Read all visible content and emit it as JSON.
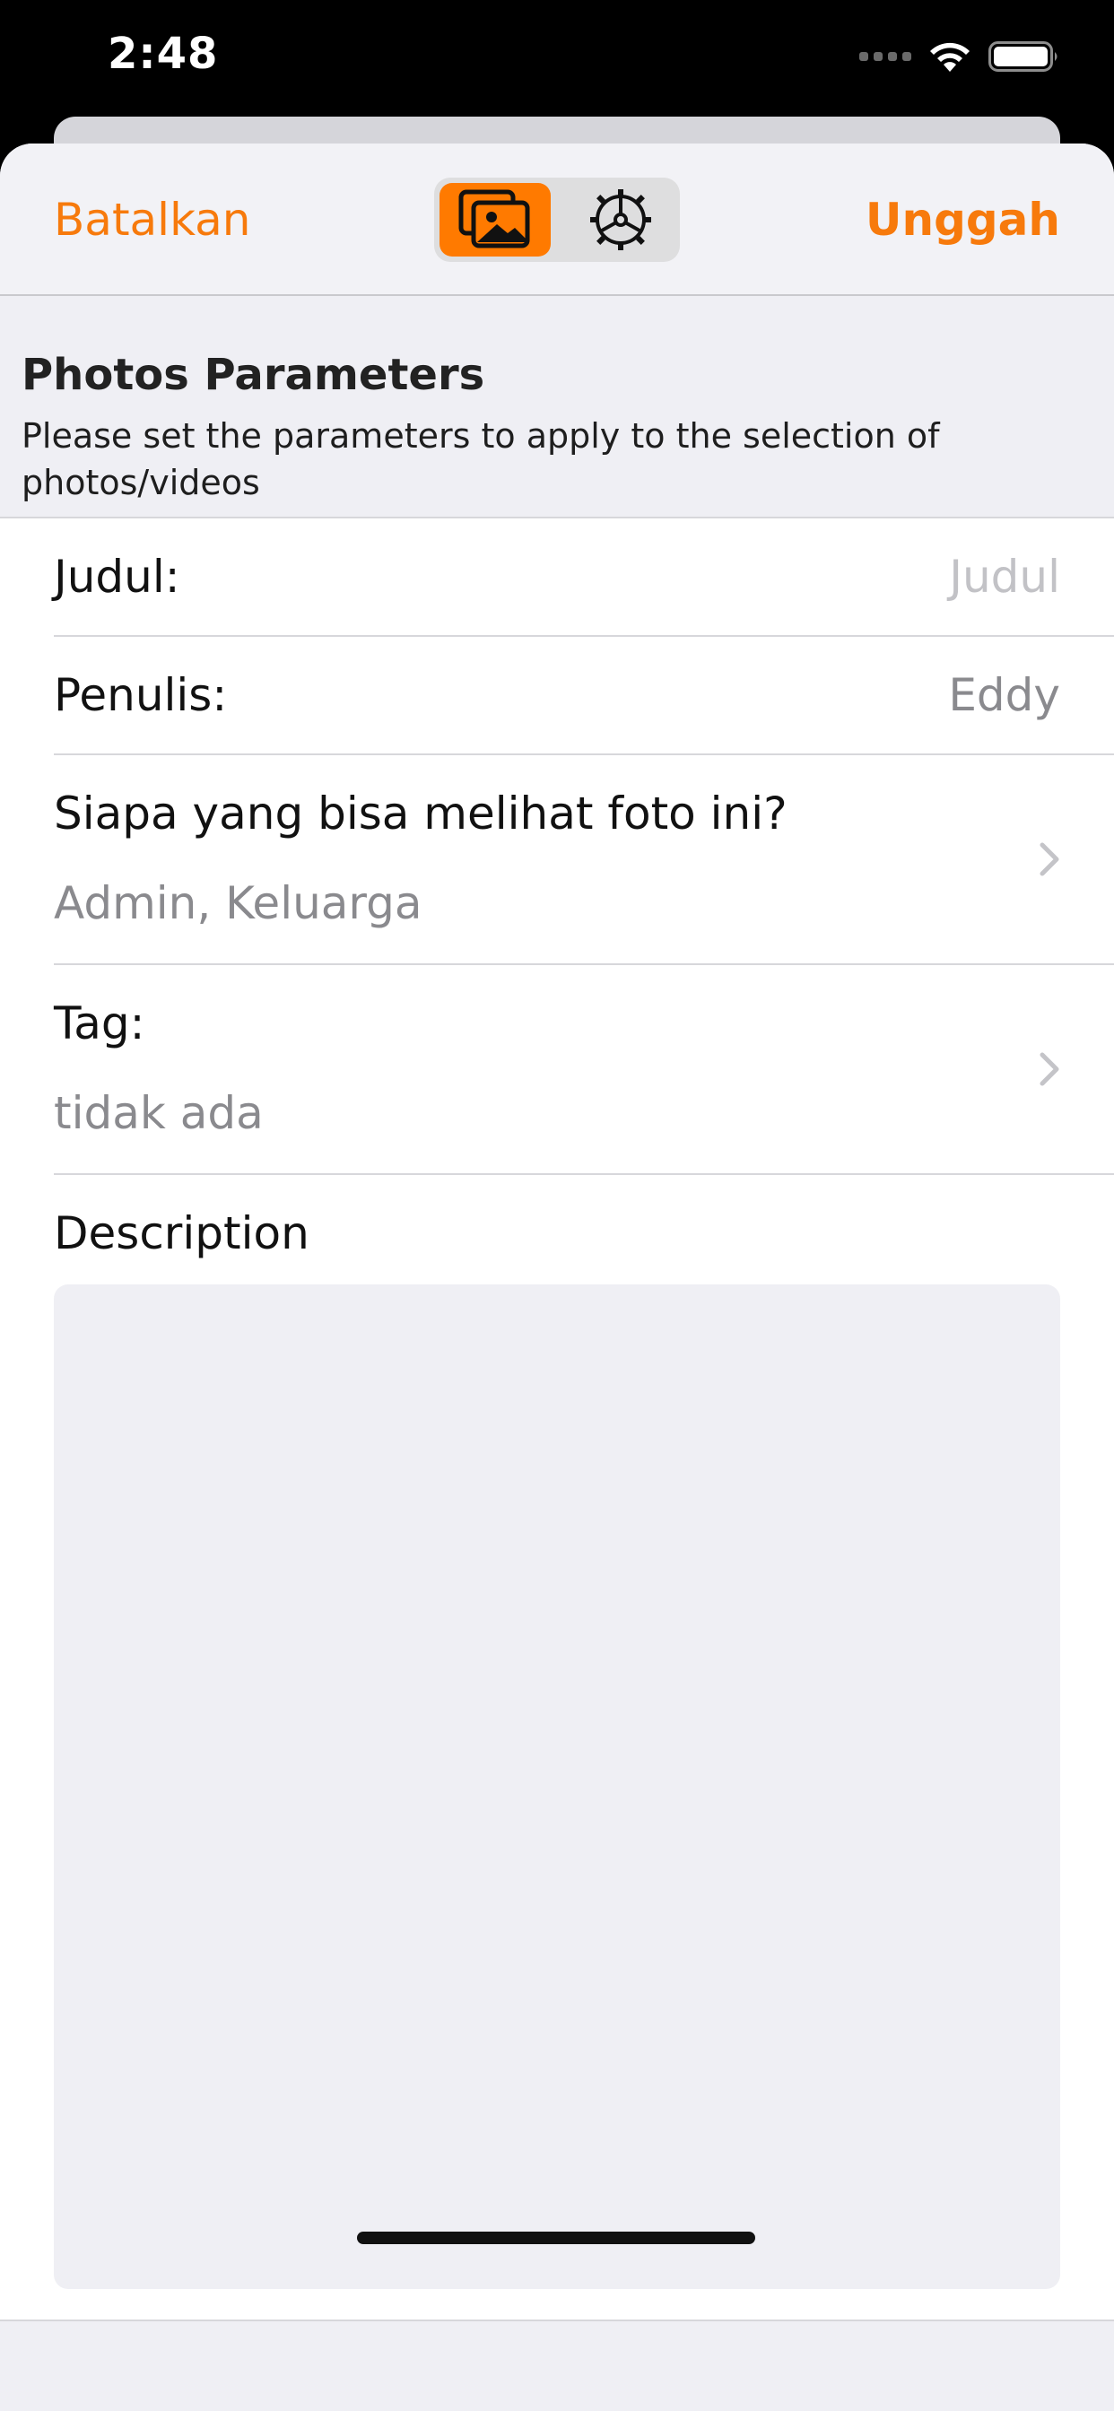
{
  "status_bar": {
    "time": "2:48"
  },
  "navbar": {
    "cancel_label": "Batalkan",
    "upload_label": "Unggah",
    "segments": [
      {
        "icon": "photos-icon",
        "selected": true
      },
      {
        "icon": "gear-icon",
        "selected": false
      }
    ],
    "accent_color": "#ff7a00"
  },
  "section": {
    "title": "Photos Parameters",
    "description": "Please set the parameters to apply to the selection of photos/videos"
  },
  "form": {
    "title_label": "Judul:",
    "title_placeholder": "Judul",
    "author_label": "Penulis:",
    "author_value": "Eddy",
    "privacy_label": "Siapa yang bisa melihat foto ini?",
    "privacy_value": "Admin, Keluarga",
    "tags_label": "Tag:",
    "tags_value": "tidak ada",
    "description_label": "Description",
    "description_value": ""
  }
}
